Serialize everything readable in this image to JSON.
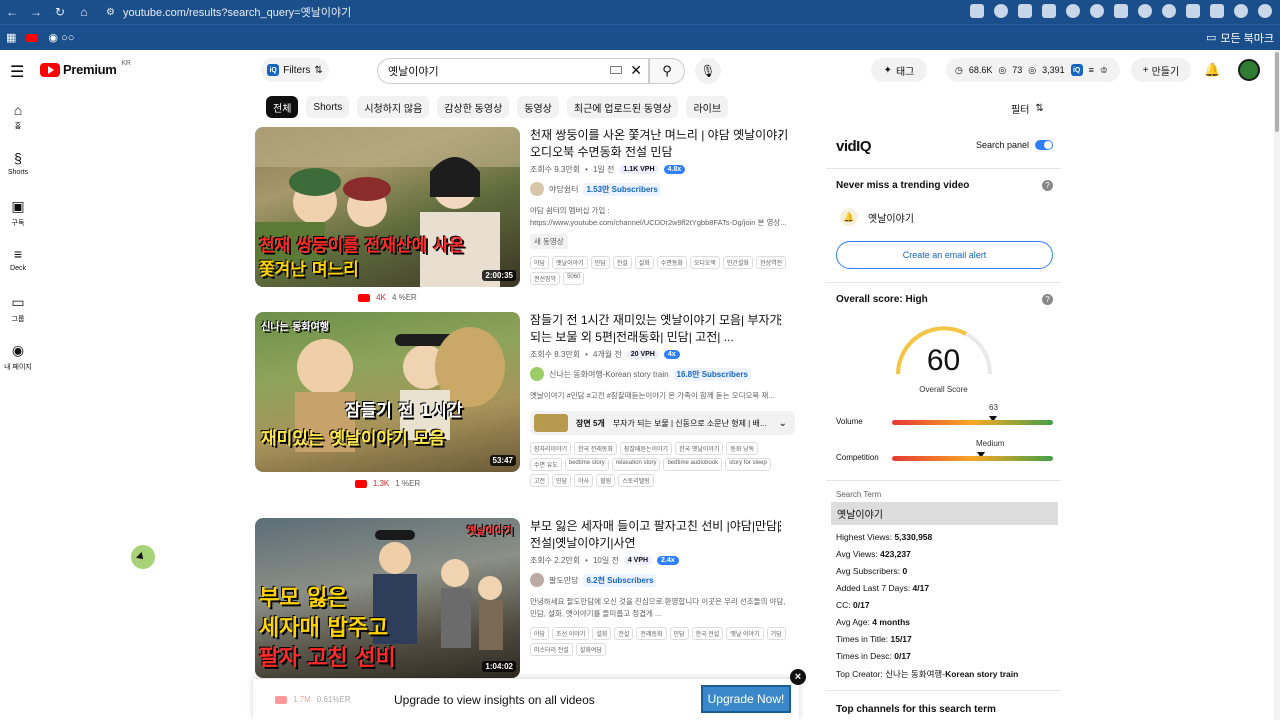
{
  "browser": {
    "url": "youtube.com/results?search_query=옛날이야기",
    "bookmarks_label": "모든 북마크"
  },
  "header": {
    "logo_text": "Premium",
    "logo_region": "KR",
    "filters_label": "Filters",
    "search_value": "옛날이야기",
    "tag_label": "태그",
    "stat_views": "68.6K",
    "stat_count": "73",
    "stat_watch": "3,391",
    "create_label": "만들기"
  },
  "sidebar": {
    "items": [
      {
        "label": "홈",
        "icon": "home-icon"
      },
      {
        "label": "Shorts",
        "icon": "shorts-icon"
      },
      {
        "label": "구독",
        "icon": "subscriptions-icon"
      },
      {
        "label": "Deck",
        "icon": "deck-icon"
      },
      {
        "label": "그룹",
        "icon": "folder-icon"
      },
      {
        "label": "내 페이지",
        "icon": "user-icon"
      }
    ]
  },
  "chips": [
    "전체",
    "Shorts",
    "시청하지 않음",
    "감상한 동영상",
    "동영상",
    "최근에 업로드된 동영상",
    "라이브"
  ],
  "filter_right_label": "필터",
  "results": [
    {
      "title": "천재 쌍둥이를 사온 쫓겨난 며느리 | 야담 옛날이야기 오디오북 수면동화 전설 민담",
      "views": "조회수 9.3만회",
      "age": "1일 전",
      "vph": "1.1K VPH",
      "multiplier": "4.8x",
      "channel": "야담쉼터",
      "subs": "1.53만 Subscribers",
      "desc": "야담 쉼터의 멤버십 가입 : https://www.youtube.com/channel/UCDDr2w9fl2tYgbb8FATs-Dg/join 본 영상...",
      "badge": "새 동영상",
      "tags": [
        "야담",
        "옛날이야기",
        "민담",
        "전설",
        "설화",
        "수면동화",
        "오디오북",
        "민간설화",
        "한샹역전",
        "권선징악",
        "5060"
      ],
      "duration": "2:00:35",
      "thumb_line1": "천재 쌍둥이를 전재산에 사온",
      "thumb_line2": "쫓겨난 며느리",
      "under_views": "4K",
      "under_er": "4 %ER"
    },
    {
      "title": "잠들기 전 1시간 재미있는 옛날이야기 모음| 부자가 되는 보물 외 5편|전래동화| 민담| 고전| ...",
      "views": "조회수 8.3만회",
      "age": "4개월 전",
      "vph": "20 VPH",
      "multiplier": "4x",
      "channel": "신나는 동화여행-Korean story train",
      "subs": "16.8만 Subscribers",
      "desc": "옛날이야기 #민담 #고전 #잠잘때듣는이야기 온 가족이 함께 듣는 오디오북 재...",
      "chapter_label": "장면 5개",
      "chapter_text": "부자가 되는 보물 | 신동으로 소문난 형제 | 배...",
      "tags": [
        "잠자리이야기",
        "한국 전래동화",
        "잠잘때듣는이야기",
        "한국 옛날이야기",
        "동화 낭독",
        "수면 유도",
        "bedtime story",
        "relaxation story",
        "bedtime audiobook",
        "story for sleep",
        "고전",
        "민담",
        "야사",
        "힐링",
        "스토리텔링"
      ],
      "duration": "53:47",
      "thumb_tag": "신나는 동화여행",
      "thumb_line1": "잠들기 전 1시간",
      "thumb_line2": "재미있는 옛날이야기 모음",
      "under_views": "1.3K",
      "under_er": "1 %ER"
    },
    {
      "title": "부모 잃은 세자매 들이고 팔자고친 선비 |야담|만담|전설|옛날이야기|사연",
      "views": "조회수 2.2만회",
      "age": "10일 전",
      "vph": "4 VPH",
      "multiplier": "2.4x",
      "channel": "팔도만담",
      "subs": "6.2천 Subscribers",
      "desc": "안녕하세요 팔도만담에 오신 것을 진심으로 환영합니다 이곳은 우리 선조들의 야담, 민담, 설화, 옛이야기를 들미룹고 정겹게 ...",
      "tags": [
        "야담",
        "조선 이야기",
        "설화",
        "전설",
        "전래동화",
        "민담",
        "한국 전설",
        "옛날 이야기",
        "기담",
        "미스터리 전설",
        "설화여담"
      ],
      "duration": "1:04:02",
      "thumb_tag": "옛날이야기",
      "thumb_line1": "부모 잃은",
      "thumb_line2": "세자매 밥주고",
      "thumb_line3": "팔자 고친 선비",
      "under_views": "1.7M",
      "under_er": "0.61%ER"
    }
  ],
  "upgrade_bar": {
    "message": "Upgrade to view insights on all videos",
    "button": "Upgrade Now!"
  },
  "panel": {
    "brand": "vidIQ",
    "search_panel_label": "Search panel",
    "trending_heading": "Never miss a trending video",
    "alert_keyword": "옛날이야기",
    "email_button": "Create an email alert",
    "overall_heading": "Overall score: High",
    "score": "60",
    "score_label": "Overall Score",
    "volume_label": "Volume",
    "volume_value": "63",
    "volume_level": 0.63,
    "competition_label": "Competition",
    "competition_value": "Medium",
    "competition_level": 0.55,
    "term_label": "Search Term",
    "term_value": "옛날이야기",
    "stats": [
      {
        "k": "Highest Views: ",
        "v": "5,330,958"
      },
      {
        "k": "Avg Views: ",
        "v": "423,237"
      },
      {
        "k": "Avg Subscribers: ",
        "v": "0"
      },
      {
        "k": "Added Last 7 Days: ",
        "v": "4/17"
      },
      {
        "k": "CC: ",
        "v": "0/17"
      },
      {
        "k": "Avg Age: ",
        "v": "4 months"
      },
      {
        "k": "Times in Title: ",
        "v": "15/17"
      },
      {
        "k": "Times in Desc: ",
        "v": "0/17"
      },
      {
        "k": "Top Creator: 신나는 동화여행-",
        "v": "Korean story train"
      }
    ],
    "top_channels_heading": "Top channels for this search term"
  },
  "colors": {
    "chrome": "#1a4f8b",
    "brand_red": "#ff0000",
    "accent_blue": "#2f80ff"
  }
}
